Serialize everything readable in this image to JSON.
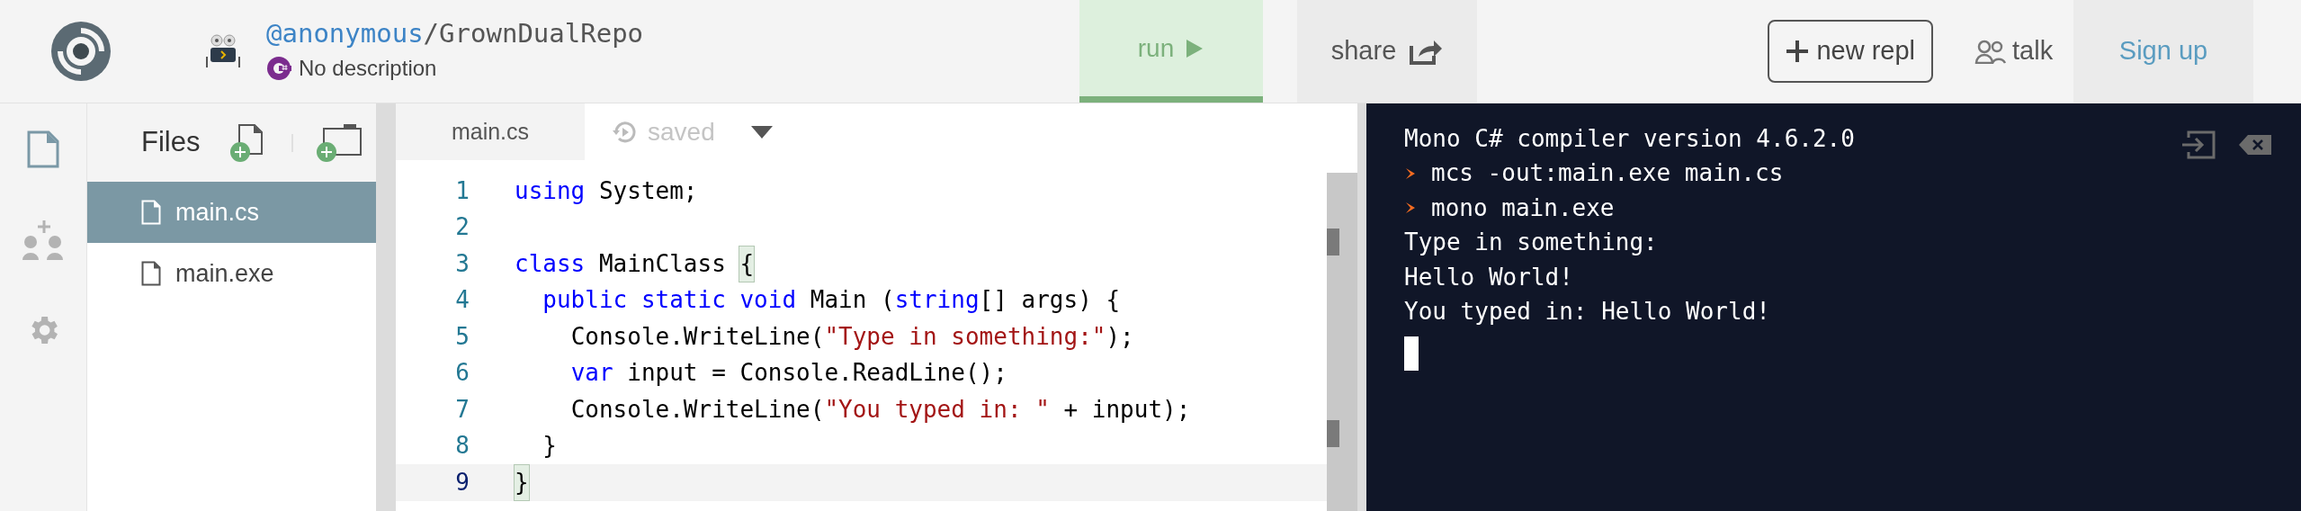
{
  "header": {
    "owner": "@anonymous",
    "separator": "/",
    "repl_name": "GrownDualRepo",
    "description": "No description",
    "run_button": "run",
    "share_button": "share",
    "new_repl_button": "new repl",
    "talk_link": "talk",
    "sign_up_link": "Sign up"
  },
  "sidebar": {
    "items": [
      {
        "kind": "files",
        "selected": true
      },
      {
        "kind": "invite",
        "selected": false
      },
      {
        "kind": "settings",
        "selected": false
      }
    ]
  },
  "files_panel": {
    "title": "Files",
    "files": [
      {
        "name": "main.cs",
        "selected": true
      },
      {
        "name": "main.exe",
        "selected": false
      }
    ]
  },
  "editor": {
    "tab": "main.cs",
    "status": "saved",
    "lines": [
      {
        "number": "1",
        "active": false,
        "tokens": [
          {
            "kind": "keyword",
            "text": "using"
          },
          {
            "kind": "plain",
            "text": " System;"
          }
        ]
      },
      {
        "number": "2",
        "active": false
      },
      {
        "number": "3",
        "active": false,
        "tokens": [
          {
            "kind": "keyword",
            "text": "class"
          },
          {
            "kind": "plain",
            "text": " MainClass "
          },
          {
            "kind": "bracket",
            "text": "{"
          }
        ]
      },
      {
        "number": "4",
        "active": false,
        "tokens": [
          {
            "kind": "keyword",
            "text": "  public static void"
          },
          {
            "kind": "plain",
            "text": " Main ("
          },
          {
            "kind": "keyword",
            "text": "string"
          },
          {
            "kind": "plain",
            "text": "[] args) {"
          }
        ]
      },
      {
        "number": "5",
        "active": false,
        "tokens": [
          {
            "kind": "plain",
            "text": "    Console.WriteLine("
          },
          {
            "kind": "string",
            "text": "\"Type in something:\""
          },
          {
            "kind": "plain",
            "text": ");"
          }
        ]
      },
      {
        "number": "6",
        "active": false,
        "tokens": [
          {
            "kind": "keyword",
            "text": "    var"
          },
          {
            "kind": "plain",
            "text": " input = Console.ReadLine();"
          }
        ]
      },
      {
        "number": "7",
        "active": false,
        "tokens": [
          {
            "kind": "plain",
            "text": "    Console.WriteLine("
          },
          {
            "kind": "string",
            "text": "\"You typed in: \""
          },
          {
            "kind": "plain",
            "text": " + input);"
          }
        ]
      },
      {
        "number": "8",
        "active": false,
        "tokens": [
          {
            "kind": "plain",
            "text": "  }"
          }
        ]
      },
      {
        "number": "9",
        "active": true,
        "tokens": [
          {
            "kind": "bracket",
            "text": "}"
          }
        ]
      }
    ]
  },
  "console": {
    "lines": [
      {
        "kind": "output",
        "text": "Mono C# compiler version 4.6.2.0"
      },
      {
        "kind": "command",
        "text": "mcs -out:main.exe main.cs"
      },
      {
        "kind": "command",
        "text": "mono main.exe"
      },
      {
        "kind": "output",
        "text": "Type in something:"
      },
      {
        "kind": "output",
        "text": "Hello World!"
      },
      {
        "kind": "output",
        "text": "You typed in: Hello World!"
      }
    ]
  }
}
